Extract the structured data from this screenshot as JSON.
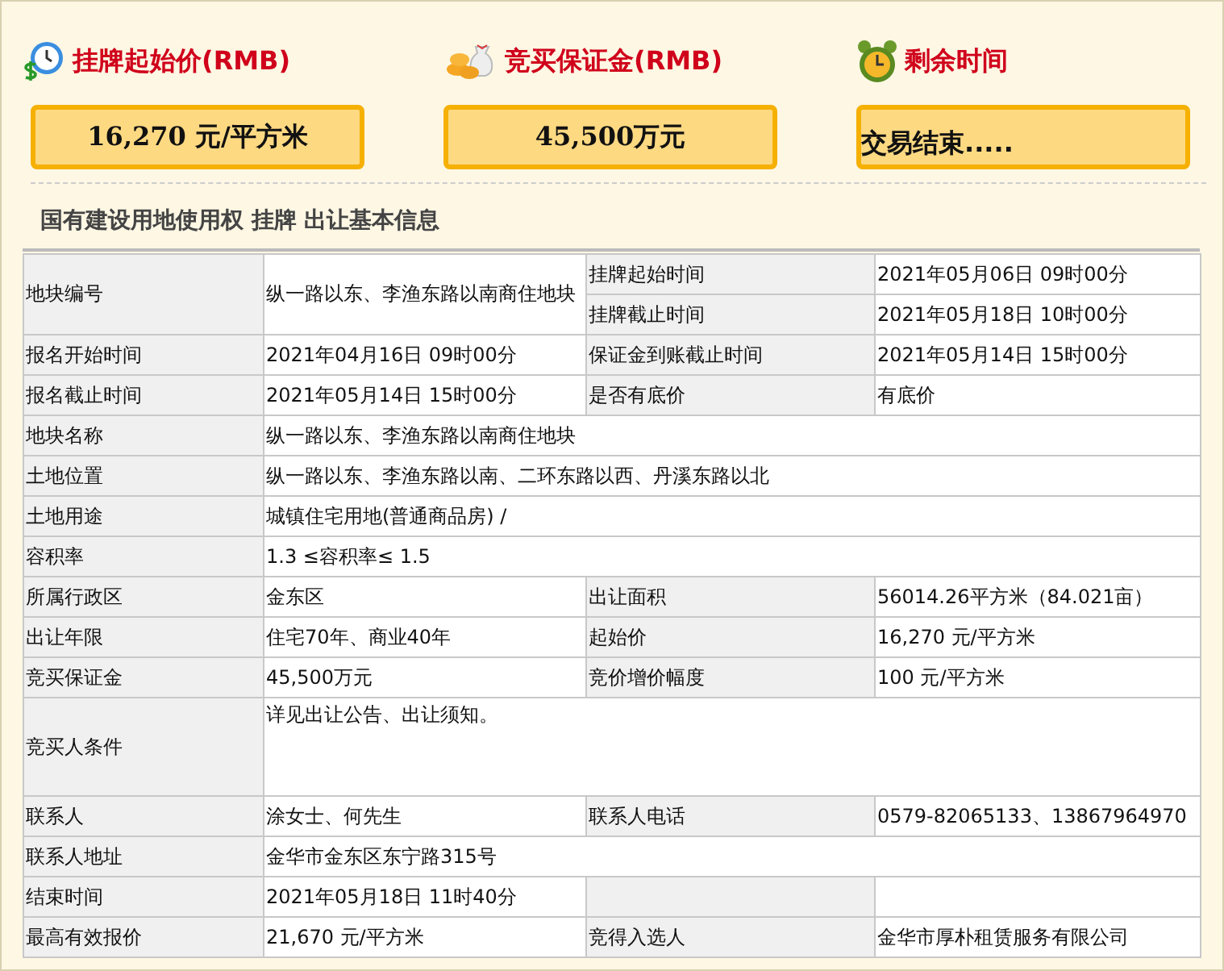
{
  "summary_cards": [
    {
      "kind": "price",
      "label": "挂牌起始价(RMB)",
      "value": "16,270 元/平方米"
    },
    {
      "kind": "deposit",
      "label": "竞买保证金(RMB)",
      "value": "45,500万元"
    },
    {
      "kind": "countdown",
      "label": "剩余时间",
      "value": "交易结束....."
    }
  ],
  "section_title": "国有建设用地使用权 挂牌 出让基本信息",
  "table": {
    "rows": [
      {
        "cells": [
          {
            "kind": "label",
            "text": "地块编号",
            "rowspan": 2
          },
          {
            "kind": "value",
            "text": "纵一路以东、李渔东路以南商住地块",
            "rowspan": 2
          },
          {
            "kind": "label",
            "text": "挂牌起始时间"
          },
          {
            "kind": "value",
            "text": "2021年05月06日 09时00分"
          }
        ]
      },
      {
        "cells": [
          {
            "kind": "label",
            "text": "挂牌截止时间"
          },
          {
            "kind": "value",
            "text": "2021年05月18日 10时00分"
          }
        ]
      },
      {
        "cells": [
          {
            "kind": "label",
            "text": "报名开始时间"
          },
          {
            "kind": "value",
            "text": "2021年04月16日 09时00分"
          },
          {
            "kind": "label",
            "text": "保证金到账截止时间"
          },
          {
            "kind": "value",
            "text": "2021年05月14日 15时00分"
          }
        ]
      },
      {
        "cells": [
          {
            "kind": "label",
            "text": "报名截止时间"
          },
          {
            "kind": "value",
            "text": "2021年05月14日 15时00分"
          },
          {
            "kind": "label",
            "text": "是否有底价"
          },
          {
            "kind": "value",
            "text": "有底价"
          }
        ]
      },
      {
        "cells": [
          {
            "kind": "label",
            "text": "地块名称"
          },
          {
            "kind": "value",
            "text": "纵一路以东、李渔东路以南商住地块",
            "colspan": 3
          }
        ]
      },
      {
        "cells": [
          {
            "kind": "label",
            "text": "土地位置"
          },
          {
            "kind": "value",
            "text": "纵一路以东、李渔东路以南、二环东路以西、丹溪东路以北",
            "colspan": 3
          }
        ]
      },
      {
        "cells": [
          {
            "kind": "label",
            "text": "土地用途"
          },
          {
            "kind": "value",
            "text": "城镇住宅用地(普通商品房) /",
            "colspan": 3
          }
        ]
      },
      {
        "cells": [
          {
            "kind": "label",
            "text": "容积率"
          },
          {
            "kind": "value",
            "text": "1.3 ≤容积率≤ 1.5",
            "colspan": 3
          }
        ]
      },
      {
        "cells": [
          {
            "kind": "label",
            "text": "所属行政区"
          },
          {
            "kind": "value",
            "text": "金东区"
          },
          {
            "kind": "label",
            "text": "出让面积"
          },
          {
            "kind": "value",
            "text": "56014.26平方米（84.021亩）"
          }
        ]
      },
      {
        "cells": [
          {
            "kind": "label",
            "text": "出让年限"
          },
          {
            "kind": "value",
            "text": "住宅70年、商业40年"
          },
          {
            "kind": "label",
            "text": "起始价"
          },
          {
            "kind": "value",
            "text": "16,270 元/平方米"
          }
        ]
      },
      {
        "cells": [
          {
            "kind": "label",
            "text": "竞买保证金"
          },
          {
            "kind": "value",
            "text": "45,500万元"
          },
          {
            "kind": "label",
            "text": "竞价增价幅度"
          },
          {
            "kind": "value",
            "text": "100 元/平方米"
          }
        ]
      },
      {
        "tall": true,
        "cells": [
          {
            "kind": "label",
            "text": "竞买人条件"
          },
          {
            "kind": "value",
            "text": "详见出让公告、出让须知。",
            "colspan": 3
          }
        ]
      },
      {
        "cells": [
          {
            "kind": "label",
            "text": "联系人"
          },
          {
            "kind": "value",
            "text": "涂女士、何先生"
          },
          {
            "kind": "label",
            "text": "联系人电话"
          },
          {
            "kind": "value",
            "text": "0579-82065133、13867964970"
          }
        ]
      },
      {
        "cells": [
          {
            "kind": "label",
            "text": "联系人地址"
          },
          {
            "kind": "value",
            "text": "金华市金东区东宁路315号",
            "colspan": 3
          }
        ]
      },
      {
        "cells": [
          {
            "kind": "label",
            "text": "结束时间"
          },
          {
            "kind": "value",
            "text": "2021年05月18日 11时40分"
          },
          {
            "kind": "label"
          },
          {
            "kind": "value"
          }
        ]
      },
      {
        "cells": [
          {
            "kind": "label",
            "text": "最高有效报价"
          },
          {
            "kind": "value",
            "text": "21,670 元/平方米"
          },
          {
            "kind": "label",
            "text": "竞得入选人"
          },
          {
            "kind": "value",
            "text": "金华市厚朴租赁服务有限公司"
          }
        ]
      }
    ]
  }
}
